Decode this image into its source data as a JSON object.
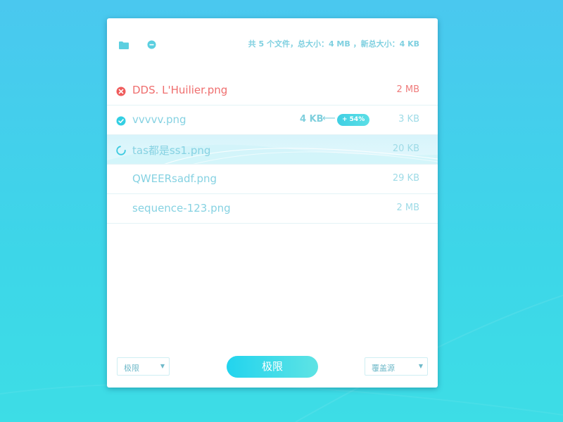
{
  "toolbar": {
    "summary": "共 5 个文件，总大小：4 MB ，新总大小：4 KB",
    "icons": [
      "folder-icon",
      "remove-icon"
    ]
  },
  "files": [
    {
      "name": "DDS. L'Huilier.png",
      "size": "2 MB",
      "status": "error"
    },
    {
      "name": "vvvvv.png",
      "size": "3 KB",
      "status": "done",
      "original": "4 KB",
      "arrow": "⟵",
      "badge": "+ 54%"
    },
    {
      "name": "tas都是ss1.png",
      "size": "20 KB",
      "status": "processing"
    },
    {
      "name": "QWEERsadf.png",
      "size": "29 KB",
      "status": "pending"
    },
    {
      "name": "sequence-123.png",
      "size": "2 MB",
      "status": "pending"
    }
  ],
  "footer": {
    "level_select": "极限",
    "compress_button": "极限",
    "output_select": "覆盖源",
    "caret": "▼"
  },
  "colors": {
    "accent": "#22d4ee",
    "error": "#ef6e6e",
    "text_light": "#86d2e2"
  }
}
